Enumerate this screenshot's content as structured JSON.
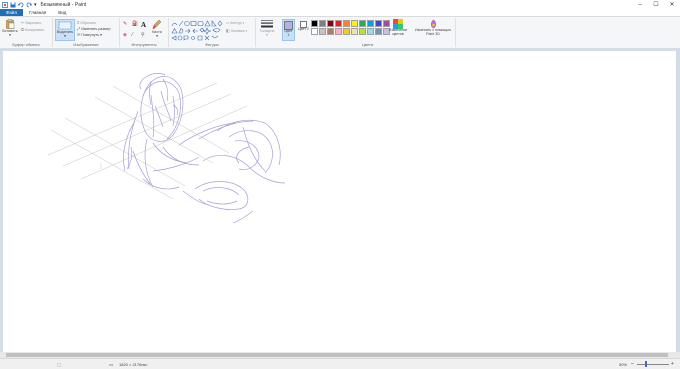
{
  "window": {
    "title": "Безымянный - Paint"
  },
  "tabs": [
    {
      "label": "Файл"
    },
    {
      "label": "Главная"
    },
    {
      "label": "Вид"
    }
  ],
  "ribbon": {
    "clipboard": {
      "paste": "Вставить",
      "cut": "Вырезать",
      "copy": "Копировать",
      "label": "Буфер обмена"
    },
    "image": {
      "select": "Выделить",
      "crop": "Обрезать",
      "resize": "Изменить размер",
      "rotate": "Повернуть",
      "label": "Изображение"
    },
    "tools": {
      "brushes": "Кисти",
      "label": "Инструменты"
    },
    "shapes": {
      "outline": "Контур",
      "fill": "Заливка",
      "label": "Фигуры"
    },
    "size": {
      "label": "Толщина"
    },
    "colors": {
      "color1": "Цвет 1",
      "color2": "Цвет 2",
      "edit": "Изменение цветов",
      "paint3d": "Изменить с помощью Paint 3D",
      "label": "Цвета",
      "palette_row1": [
        "#000000",
        "#7f7f7f",
        "#880015",
        "#ed1c24",
        "#ff7f27",
        "#fff200",
        "#22b14c",
        "#00a2e8",
        "#3f48cc",
        "#a349a4"
      ],
      "palette_row2": [
        "#ffffff",
        "#c3c3c3",
        "#b97a57",
        "#ffaec9",
        "#ffc90e",
        "#efe4b0",
        "#b5e61d",
        "#99d9ea",
        "#7092be",
        "#c8bfe7"
      ],
      "active_color": "#b4b0e6"
    }
  },
  "status": {
    "dimensions": "1820 × 2176пкс",
    "zoom": "50%"
  }
}
